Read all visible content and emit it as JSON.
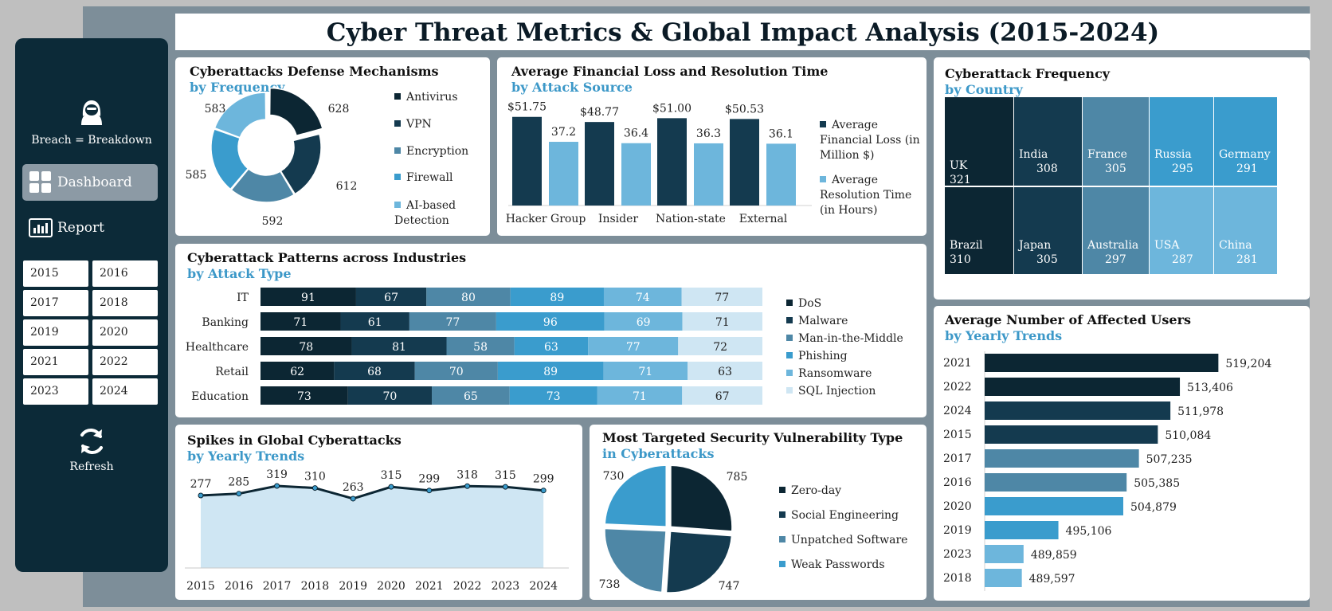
{
  "title": "Cyber Threat Metrics & Global Impact Analysis (2015-2024)",
  "sidebar": {
    "brand": "Breach = Breakdown",
    "nav": [
      {
        "label": "Dashboard",
        "icon": "dashboard-icon"
      },
      {
        "label": "Report",
        "icon": "report-icon"
      }
    ],
    "years": [
      "2015",
      "2016",
      "2017",
      "2018",
      "2019",
      "2020",
      "2021",
      "2022",
      "2023",
      "2024"
    ],
    "refresh": "Refresh"
  },
  "colors": {
    "c1": "#0c2633",
    "c2": "#143a4f",
    "c3": "#4e87a6",
    "c4": "#3a9ccd",
    "c5": "#6db6dc",
    "c6": "#cfe6f3"
  },
  "defense": {
    "title": "Cyberattacks Defense Mechanisms",
    "subtitle": "by Frequency",
    "legend": [
      "Antivirus",
      "VPN",
      "Encryption",
      "Firewall",
      "AI-based Detection"
    ],
    "labels": [
      "628",
      "612",
      "592",
      "585",
      "583"
    ]
  },
  "financial": {
    "title": "Average Financial Loss and Resolution Time",
    "subtitle": "by Attack Source",
    "legend": [
      "Average Financial Loss (in Million $)",
      "Average Resolution Time (in Hours)"
    ],
    "loss_labels": [
      "$51.75",
      "$48.77",
      "$51.00",
      "$50.53"
    ],
    "time_labels": [
      "37.2",
      "36.4",
      "36.3",
      "36.1"
    ]
  },
  "country": {
    "title": "Cyberattack Frequency",
    "subtitle": "by Country",
    "cells": [
      {
        "name": "UK",
        "value": "321"
      },
      {
        "name": "India",
        "value": "308"
      },
      {
        "name": "France",
        "value": "305"
      },
      {
        "name": "Russia",
        "value": "295"
      },
      {
        "name": "Germany",
        "value": "291"
      },
      {
        "name": "Brazil",
        "value": "310"
      },
      {
        "name": "Japan",
        "value": "305"
      },
      {
        "name": "Australia",
        "value": "297"
      },
      {
        "name": "USA",
        "value": "287"
      },
      {
        "name": "China",
        "value": "281"
      }
    ]
  },
  "industries": {
    "title": "Cyberattack Patterns across Industries",
    "subtitle": "by Attack Type",
    "legend": [
      "DoS",
      "Malware",
      "Man-in-the-Middle",
      "Phishing",
      "Ransomware",
      "SQL Injection"
    ]
  },
  "affected": {
    "title": "Average Number of Affected Users",
    "subtitle": "by Yearly Trends",
    "labels": [
      "519,204",
      "513,406",
      "511,978",
      "510,084",
      "507,235",
      "505,385",
      "504,879",
      "495,106",
      "489,859",
      "489,597"
    ]
  },
  "spikes": {
    "title": "Spikes in Global Cyberattacks",
    "subtitle": "by Yearly Trends"
  },
  "vuln": {
    "title": "Most Targeted Security Vulnerability Type",
    "subtitle": "in Cyberattacks",
    "legend": [
      "Zero-day",
      "Social Engineering",
      "Unpatched Software",
      "Weak Passwords"
    ],
    "labels": [
      "785",
      "747",
      "738",
      "730"
    ]
  },
  "chart_data": [
    {
      "type": "pie",
      "title": "Cyberattacks Defense Mechanisms",
      "categories": [
        "Antivirus",
        "VPN",
        "Encryption",
        "Firewall",
        "AI-based Detection"
      ],
      "values": [
        628,
        612,
        592,
        585,
        583
      ]
    },
    {
      "type": "bar",
      "title": "Average Financial Loss and Resolution Time",
      "categories": [
        "Hacker Group",
        "Insider",
        "Nation-state",
        "External"
      ],
      "series": [
        {
          "name": "Average Financial Loss (in Million $)",
          "values": [
            51.75,
            48.77,
            51.0,
            50.53
          ]
        },
        {
          "name": "Average Resolution Time (in Hours)",
          "values": [
            37.2,
            36.4,
            36.3,
            36.1
          ]
        }
      ]
    },
    {
      "type": "heatmap",
      "title": "Cyberattack Frequency",
      "categories": [
        "UK",
        "India",
        "France",
        "Russia",
        "Germany",
        "Brazil",
        "Japan",
        "Australia",
        "USA",
        "China"
      ],
      "values": [
        321,
        308,
        305,
        295,
        291,
        310,
        305,
        297,
        287,
        281
      ]
    },
    {
      "type": "bar",
      "title": "Cyberattack Patterns across Industries",
      "categories": [
        "IT",
        "Banking",
        "Healthcare",
        "Retail",
        "Education"
      ],
      "series": [
        {
          "name": "DoS",
          "values": [
            91,
            71,
            78,
            62,
            73
          ]
        },
        {
          "name": "Malware",
          "values": [
            67,
            61,
            81,
            68,
            70
          ]
        },
        {
          "name": "Man-in-the-Middle",
          "values": [
            80,
            77,
            58,
            70,
            65
          ]
        },
        {
          "name": "Phishing",
          "values": [
            89,
            96,
            63,
            89,
            73
          ]
        },
        {
          "name": "Ransomware",
          "values": [
            74,
            69,
            77,
            71,
            71
          ]
        },
        {
          "name": "SQL Injection",
          "values": [
            77,
            71,
            72,
            63,
            67
          ]
        }
      ]
    },
    {
      "type": "bar",
      "title": "Average Number of Affected Users",
      "categories": [
        "2021",
        "2022",
        "2024",
        "2015",
        "2017",
        "2016",
        "2020",
        "2019",
        "2023",
        "2018"
      ],
      "values": [
        519204,
        513406,
        511978,
        510084,
        507235,
        505385,
        504879,
        495106,
        489859,
        489597
      ]
    },
    {
      "type": "area",
      "title": "Spikes in Global Cyberattacks",
      "x": [
        "2015",
        "2016",
        "2017",
        "2018",
        "2019",
        "2020",
        "2021",
        "2022",
        "2023",
        "2024"
      ],
      "values": [
        277,
        285,
        319,
        310,
        263,
        315,
        299,
        318,
        315,
        299
      ]
    },
    {
      "type": "pie",
      "title": "Most Targeted Security Vulnerability Type",
      "categories": [
        "Zero-day",
        "Social Engineering",
        "Unpatched Software",
        "Weak Passwords"
      ],
      "values": [
        785,
        747,
        738,
        730
      ]
    }
  ]
}
